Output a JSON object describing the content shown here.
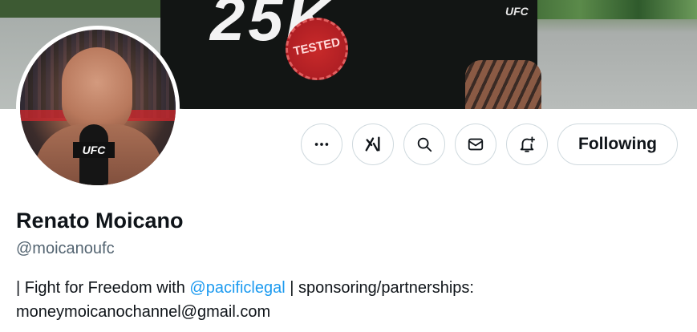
{
  "banner": {
    "shirt_text": "25K",
    "stamp_text": "TESTED",
    "sleeve_text": "UFC"
  },
  "avatar": {
    "mic_label": "UFC"
  },
  "actions": {
    "more_icon": "more-horizontal-icon",
    "grok_icon": "grok-icon",
    "search_icon": "search-icon",
    "message_icon": "mail-icon",
    "notify_icon": "bell-plus-icon",
    "follow_label": "Following"
  },
  "profile": {
    "name": "Renato Moicano",
    "handle": "@moicanoufc",
    "bio_prefix": "| Fight for Freedom with ",
    "bio_mention": "@pacificlegal",
    "bio_suffix": " | sponsoring/partnerships:",
    "bio_line2": "moneymoicanochannel@gmail.com"
  },
  "colors": {
    "text": "#0f1419",
    "secondary": "#536471",
    "link": "#1d9bf0",
    "border": "#cfd9de"
  }
}
